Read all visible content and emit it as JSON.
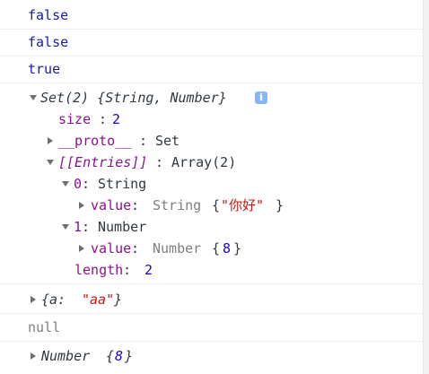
{
  "console": {
    "messages": [
      {
        "text": "false"
      },
      {
        "text": "false"
      },
      {
        "text": "true"
      }
    ],
    "set_entry": {
      "header": "Set(2) {String, Number}",
      "size_key": "size",
      "size_val": "2",
      "proto_key": "__proto__",
      "proto_val": "Set",
      "entries_key": "[[Entries]]",
      "entries_val": "Array(2)",
      "item0_key": "0",
      "item0_type": "String",
      "item0_value_key": "value",
      "item0_value_type": "String",
      "item0_value_open": "{",
      "item0_value_str": "\"你好\"",
      "item0_value_close": "}",
      "item1_key": "1",
      "item1_type": "Number",
      "item1_value_key": "value",
      "item1_value_type": "Number",
      "item1_value_open": "{",
      "item1_value_num": "8",
      "item1_value_close": "}",
      "length_key": "length",
      "length_val": "2"
    },
    "object_entry": {
      "open": "{a: ",
      "str": "\"aa\"",
      "close": "}"
    },
    "null_entry": "null",
    "number_entry": {
      "label": "Number ",
      "open": "{",
      "num": "8",
      "close": "}"
    },
    "colors": {
      "boolean": "#1a1aa6",
      "key": "#881391",
      "number": "#1c00cf",
      "string": "#c41a16"
    }
  }
}
